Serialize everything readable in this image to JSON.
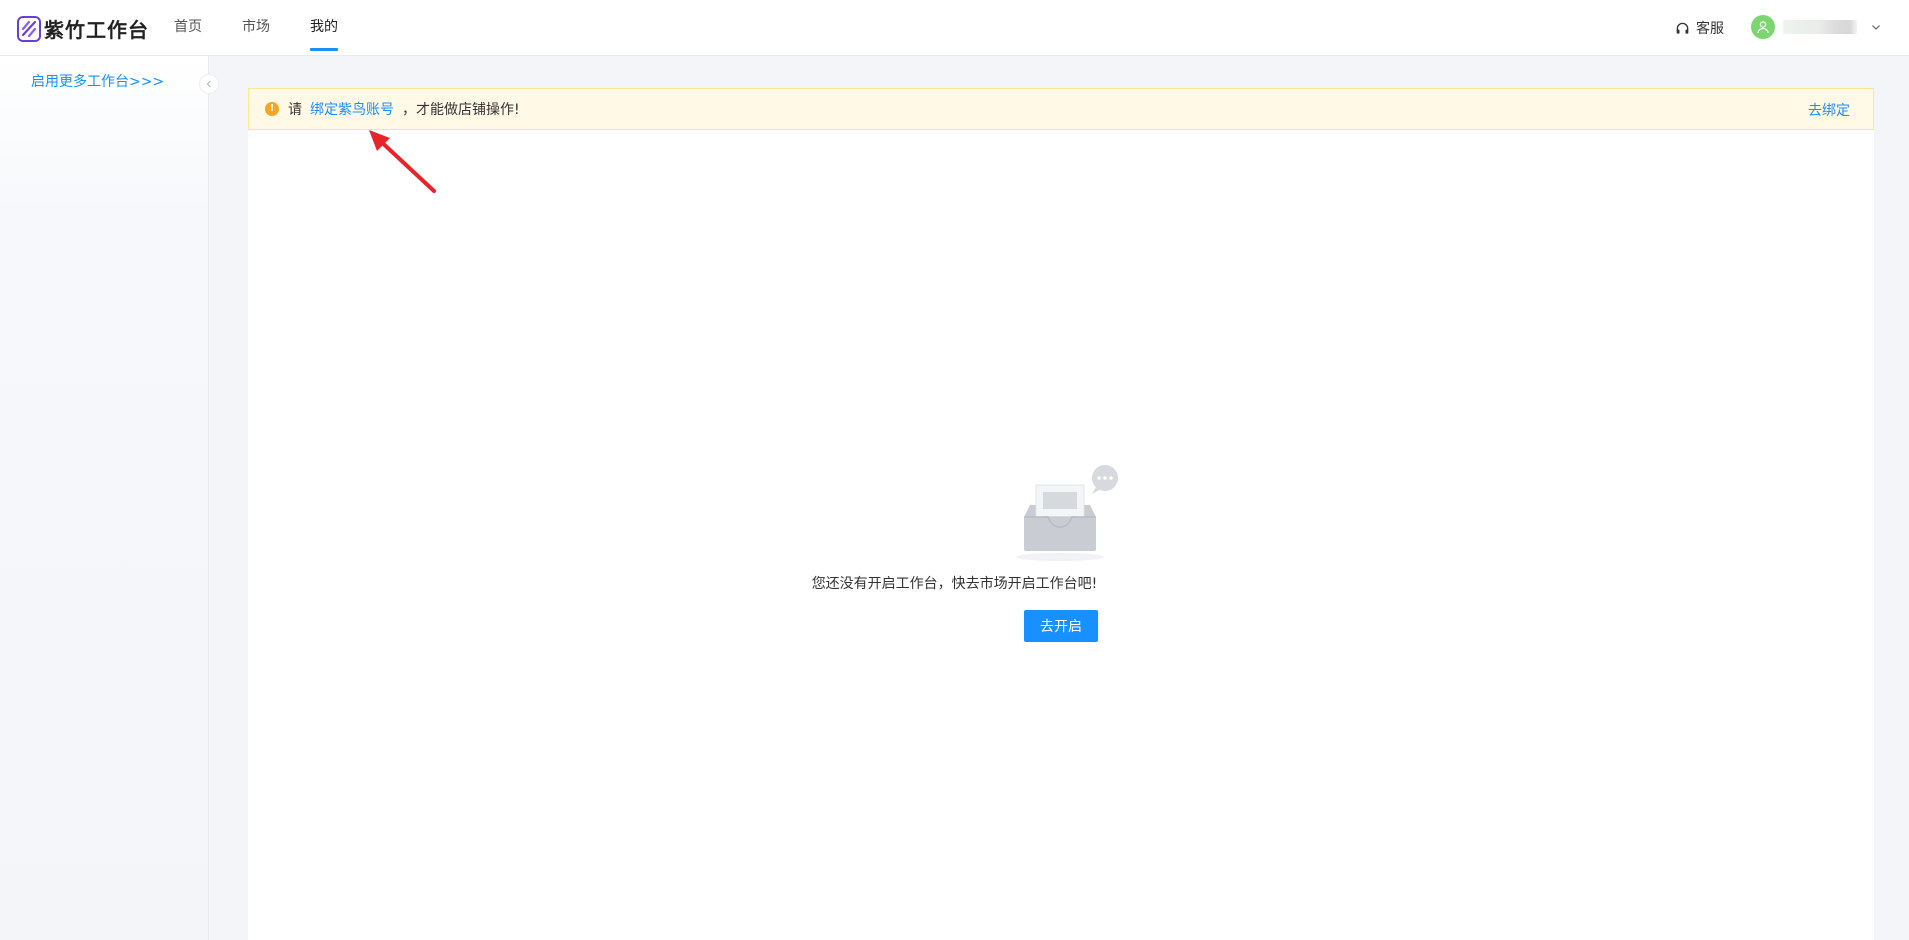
{
  "app": {
    "title": "紫竹工作台",
    "logo_icon": "zizhu-logo-icon"
  },
  "nav": {
    "items": [
      {
        "label": "首页",
        "active": false
      },
      {
        "label": "市场",
        "active": false
      },
      {
        "label": "我的",
        "active": true
      }
    ]
  },
  "header_right": {
    "support_label": "客服",
    "support_icon": "headset-icon",
    "user_avatar_icon": "user-avatar-icon",
    "user_menu_icon": "chevron-down-icon"
  },
  "sidebar": {
    "link_label": "启用更多工作台>>>",
    "collapse_icon": "chevron-left-icon"
  },
  "alert": {
    "icon": "warning-icon",
    "icon_glyph": "!",
    "prefix": "请",
    "link_label": "绑定紫鸟账号",
    "suffix": "，才能做店铺操作!",
    "action_label": "去绑定"
  },
  "empty_state": {
    "illustration": "empty-inbox-illustration",
    "message": "您还没有开启工作台，快去市场开启工作台吧!",
    "button_label": "去开启"
  },
  "colors": {
    "accent": "#1890ff",
    "alert_bg": "#fff9e6",
    "alert_border": "#ffe59a",
    "warning": "#f5a623",
    "annotation_arrow": "#e8232a",
    "avatar_bg": "#7bd66f"
  }
}
